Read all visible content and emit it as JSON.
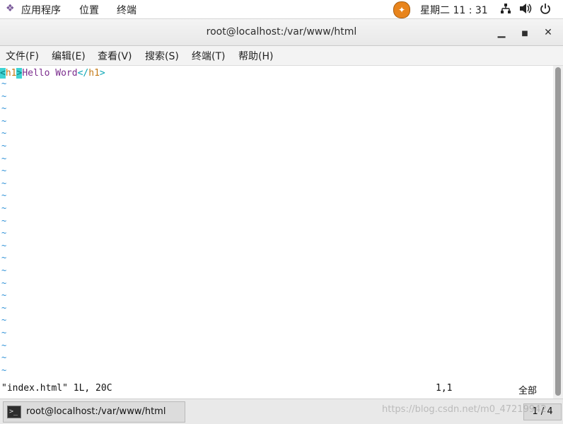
{
  "topbar": {
    "apps_label": "应用程序",
    "places_label": "位置",
    "terminal_label": "终端",
    "clock": "星期二 11 : 31"
  },
  "window": {
    "title": "root@localhost:/var/www/html"
  },
  "menu": {
    "file": "文件(F)",
    "edit": "编辑(E)",
    "view": "查看(V)",
    "search": "搜索(S)",
    "terminal": "终端(T)",
    "help": "帮助(H)"
  },
  "editor": {
    "line1": {
      "open_lt": "<",
      "open_name": "h1",
      "open_gt": ">",
      "text": "Hello Word",
      "close_lt": "</",
      "close_name": "h1",
      "close_gt": ">"
    },
    "tilde": "~",
    "status_file": "\"index.html\" 1L, 20C",
    "status_pos": "1,1",
    "status_all": "全部"
  },
  "taskbar": {
    "task_label": "root@localhost:/var/www/html",
    "pager": "1 / 4",
    "watermark": "https://blog.csdn.net/m0_47219942"
  },
  "colors": {
    "cursor": "#3fd3d3",
    "tag_bracket": "#0aa6b5",
    "tag_name": "#c47a16",
    "text": "#7b2d8e",
    "tilde": "#2a8fd6"
  }
}
